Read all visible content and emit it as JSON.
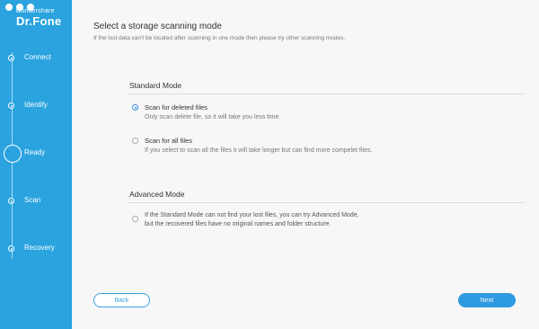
{
  "brand": {
    "top": "wondershare",
    "name": "Dr.Fone"
  },
  "steps": [
    {
      "label": "Connect",
      "state": "done"
    },
    {
      "label": "Identify",
      "state": "done"
    },
    {
      "label": "Ready",
      "state": "current"
    },
    {
      "label": "Scan",
      "state": "pending"
    },
    {
      "label": "Recovery",
      "state": "pending"
    }
  ],
  "header": {
    "title": "Select a storage scanning mode",
    "subtitle": "If the lost data can't be located after scanning in one mode then please try other scanning modes."
  },
  "standard": {
    "title": "Standard Mode",
    "options": [
      {
        "label": "Scan for deleted files",
        "description": "Only scan delete file, so it will take you less time.",
        "selected": true
      },
      {
        "label": "Scan for all files",
        "description": "If you select to scan all the files it will take longer but can find more compelet files.",
        "selected": false
      }
    ]
  },
  "advanced": {
    "title": "Advanced Mode",
    "line1": "If the Standard Mode can not find your lost files, you can try Advanced Mode,",
    "line2": "but the recovered files have no original names and folder structure.",
    "selected": false
  },
  "buttons": {
    "back": "Back",
    "next": "Next"
  },
  "colors": {
    "sidebar": "#2aa3df",
    "accent": "#2e9ae0"
  }
}
